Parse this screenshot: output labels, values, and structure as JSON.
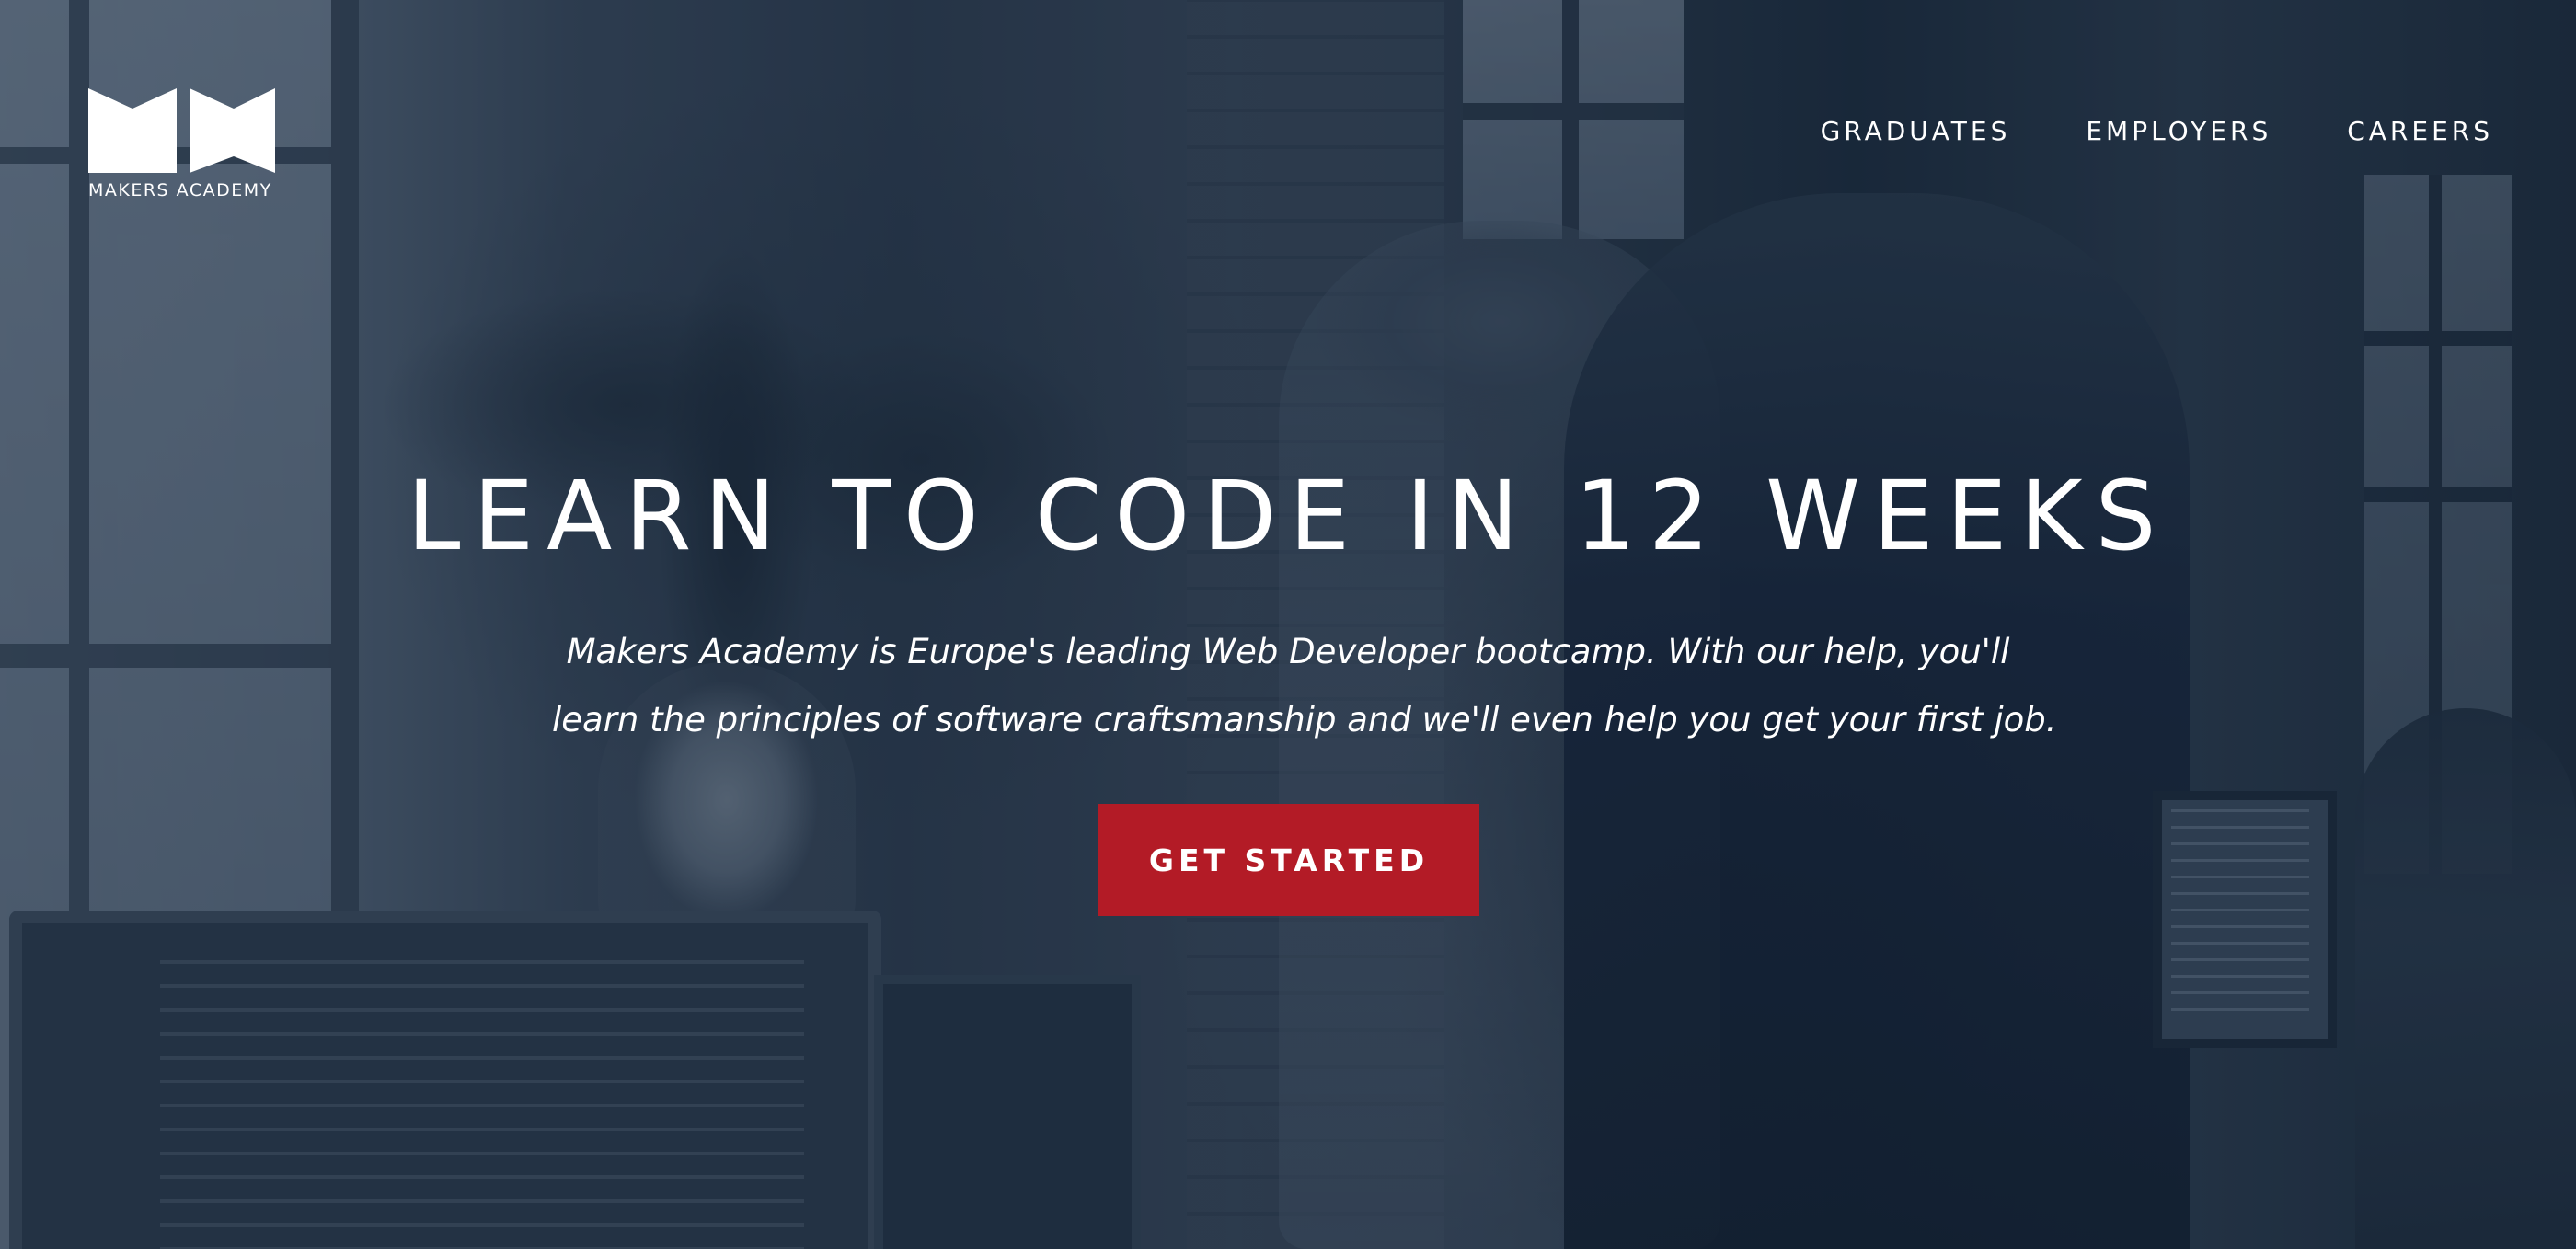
{
  "brand": {
    "name": "MAKERS ACADEMY",
    "logo_icon": "makers-academy-logo"
  },
  "nav": {
    "items": [
      {
        "label": "GRADUATES"
      },
      {
        "label": "EMPLOYERS"
      },
      {
        "label": "CAREERS"
      }
    ]
  },
  "hero": {
    "headline": "LEARN TO CODE IN 12 WEEKS",
    "subtitle_line1": "Makers Academy is Europe's leading Web Developer bootcamp. With our help, you'll",
    "subtitle_line2": "learn the principles of software craftsmanship and we'll even help you get your first job.",
    "cta_label": "GET STARTED"
  },
  "colors": {
    "overlay": "#1b2838",
    "cta_background": "#b31b26",
    "text": "#ffffff"
  }
}
